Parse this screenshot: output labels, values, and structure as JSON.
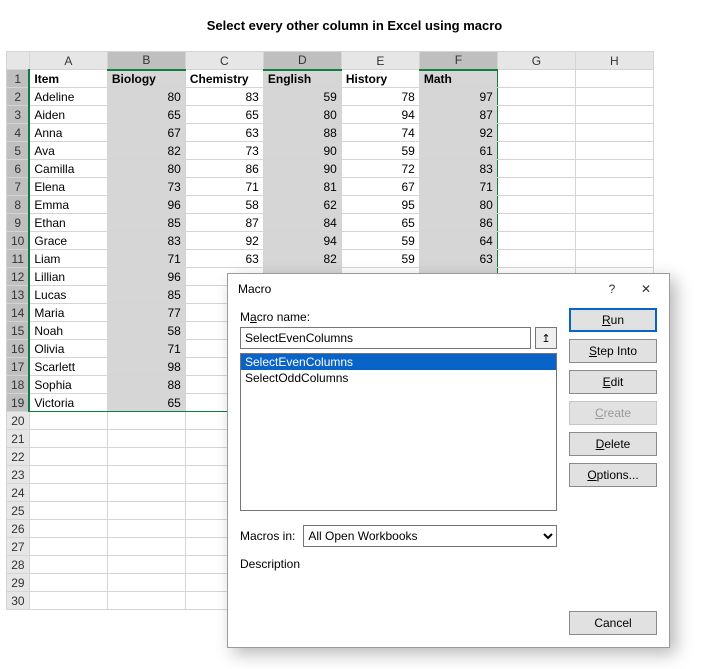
{
  "title": "Select every other column in Excel using macro",
  "columns": [
    "A",
    "B",
    "C",
    "D",
    "E",
    "F",
    "G",
    "H"
  ],
  "data_col_count": 6,
  "row_count_visible": 30,
  "headers": [
    "Item",
    "Biology",
    "Chemistry",
    "English",
    "History",
    "Math"
  ],
  "rows": [
    [
      "Adeline",
      80,
      83,
      59,
      78,
      97
    ],
    [
      "Aiden",
      65,
      65,
      80,
      94,
      87
    ],
    [
      "Anna",
      67,
      63,
      88,
      74,
      92
    ],
    [
      "Ava",
      82,
      73,
      90,
      59,
      61
    ],
    [
      "Camilla",
      80,
      86,
      90,
      72,
      83
    ],
    [
      "Elena",
      73,
      71,
      81,
      67,
      71
    ],
    [
      "Emma",
      96,
      58,
      62,
      95,
      80
    ],
    [
      "Ethan",
      85,
      87,
      84,
      65,
      86
    ],
    [
      "Grace",
      83,
      92,
      94,
      59,
      64
    ],
    [
      "Liam",
      71,
      63,
      82,
      59,
      63
    ],
    [
      "Lillian",
      96,
      null,
      null,
      null,
      null
    ],
    [
      "Lucas",
      85,
      null,
      null,
      null,
      null
    ],
    [
      "Maria",
      77,
      null,
      null,
      null,
      null
    ],
    [
      "Noah",
      58,
      null,
      null,
      null,
      null
    ],
    [
      "Olivia",
      71,
      null,
      null,
      null,
      null
    ],
    [
      "Scarlett",
      98,
      null,
      null,
      null,
      null
    ],
    [
      "Sophia",
      88,
      null,
      null,
      null,
      null
    ],
    [
      "Victoria",
      65,
      null,
      null,
      null,
      null
    ]
  ],
  "selected_col_indices": [
    1,
    3,
    5
  ],
  "dialog": {
    "title": "Macro",
    "help_glyph": "?",
    "close_glyph": "✕",
    "name_label_plain": "M",
    "name_label_ul": "a",
    "name_label_rest": "cro name:",
    "name_value": "SelectEvenColumns",
    "ref_glyph": "↥",
    "list": [
      "SelectEvenColumns",
      "SelectOddColumns"
    ],
    "list_selected": 0,
    "macros_in_label": "Macros in:",
    "macros_in_value": "All Open Workbooks",
    "description_label": "Description",
    "buttons": {
      "run_ul": "R",
      "run_rest": "un",
      "step_ul": "S",
      "step_rest": "tep Into",
      "edit_ul": "E",
      "edit_rest": "dit",
      "create_ul": "C",
      "create_rest": "reate",
      "delete_ul": "D",
      "delete_rest": "elete",
      "options_ul": "O",
      "options_rest": "ptions...",
      "cancel": "Cancel"
    }
  }
}
